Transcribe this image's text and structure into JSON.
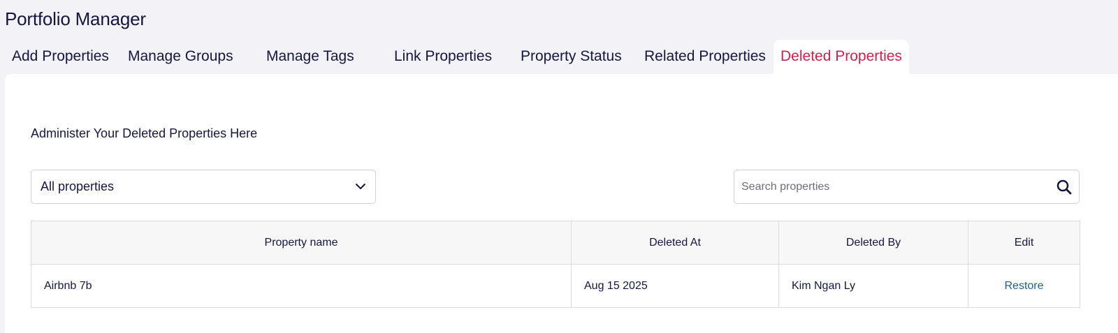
{
  "app": {
    "title": "Portfolio Manager"
  },
  "tabs": [
    {
      "label": "Add Properties",
      "active": false
    },
    {
      "label": "Manage Groups",
      "active": false
    },
    {
      "label": "Manage Tags",
      "active": false
    },
    {
      "label": "Link Properties",
      "active": false
    },
    {
      "label": "Property Status",
      "active": false
    },
    {
      "label": "Related Properties",
      "active": false
    },
    {
      "label": "Deleted Properties",
      "active": true
    }
  ],
  "panel": {
    "heading": "Administer Your Deleted Properties Here",
    "filter": {
      "selected": "All properties"
    },
    "search": {
      "placeholder": "Search properties",
      "value": ""
    },
    "table": {
      "headers": [
        "Property name",
        "Deleted At",
        "Deleted By",
        "Edit"
      ],
      "rows": [
        {
          "property_name": "Airbnb 7b",
          "deleted_at": "Aug 15 2025",
          "deleted_by": "Kim Ngan Ly",
          "action": "Restore"
        }
      ]
    }
  },
  "colors": {
    "active_tab": "#d21f4b",
    "text_primary": "#15163f",
    "link": "#1f5e94",
    "background": "#f3f2f7"
  },
  "icons": {
    "select": "chevron-down-icon",
    "search": "search-icon"
  }
}
